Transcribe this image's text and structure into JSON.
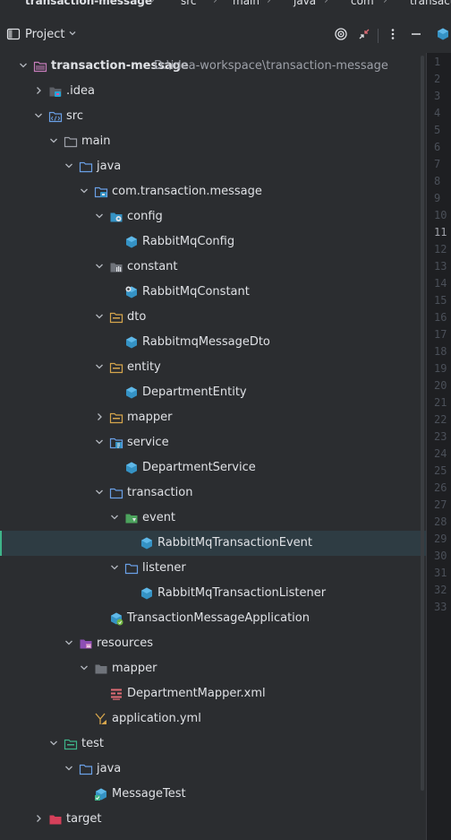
{
  "breadcrumb": [
    "transaction-message",
    "src",
    "main",
    "java",
    "com",
    "transact"
  ],
  "toolwindow": {
    "title": "Project"
  },
  "project_path": "D:\\idea-workspace\\transaction-message",
  "tree": [
    {
      "label": "transaction-message",
      "chevron": "down",
      "icon": "module",
      "bold": true
    },
    {
      "label": ".idea",
      "chevron": "right",
      "icon": "idea-folder"
    },
    {
      "label": "src",
      "chevron": "down",
      "icon": "src-folder"
    },
    {
      "label": "main",
      "chevron": "down",
      "icon": "folder"
    },
    {
      "label": "java",
      "chevron": "down",
      "icon": "source-root"
    },
    {
      "label": "com.transaction.message",
      "chevron": "down",
      "icon": "package-app"
    },
    {
      "label": "config",
      "chevron": "down",
      "icon": "config-folder"
    },
    {
      "label": "RabbitMqConfig",
      "chevron": "none",
      "icon": "class"
    },
    {
      "label": "constant",
      "chevron": "down",
      "icon": "constant-folder"
    },
    {
      "label": "RabbitMqConstant",
      "chevron": "none",
      "icon": "constant-class"
    },
    {
      "label": "dto",
      "chevron": "down",
      "icon": "package"
    },
    {
      "label": "RabbitmqMessageDto",
      "chevron": "none",
      "icon": "class"
    },
    {
      "label": "entity",
      "chevron": "down",
      "icon": "package"
    },
    {
      "label": "DepartmentEntity",
      "chevron": "none",
      "icon": "class"
    },
    {
      "label": "mapper",
      "chevron": "right",
      "icon": "package"
    },
    {
      "label": "service",
      "chevron": "down",
      "icon": "service-folder"
    },
    {
      "label": "DepartmentService",
      "chevron": "none",
      "icon": "class"
    },
    {
      "label": "transaction",
      "chevron": "down",
      "icon": "source-root"
    },
    {
      "label": "event",
      "chevron": "down",
      "icon": "event-folder"
    },
    {
      "label": "RabbitMqTransactionEvent",
      "chevron": "none",
      "icon": "class",
      "selected": true
    },
    {
      "label": "listener",
      "chevron": "down",
      "icon": "source-root"
    },
    {
      "label": "RabbitMqTransactionListener",
      "chevron": "none",
      "icon": "class"
    },
    {
      "label": "TransactionMessageApplication",
      "chevron": "none",
      "icon": "spring-class"
    },
    {
      "label": "resources",
      "chevron": "down",
      "icon": "resources-folder"
    },
    {
      "label": "mapper",
      "chevron": "down",
      "icon": "folder-plain"
    },
    {
      "label": "DepartmentMapper.xml",
      "chevron": "none",
      "icon": "xml-file"
    },
    {
      "label": "application.yml",
      "chevron": "none",
      "icon": "yml-file"
    },
    {
      "label": "test",
      "chevron": "down",
      "icon": "test-folder"
    },
    {
      "label": "java",
      "chevron": "down",
      "icon": "source-root"
    },
    {
      "label": "MessageTest",
      "chevron": "none",
      "icon": "test-class"
    },
    {
      "label": "target",
      "chevron": "right",
      "icon": "target-folder"
    }
  ],
  "line_numbers": [
    "1",
    "2",
    "3",
    "4",
    "5",
    "6",
    "7",
    "8",
    "9",
    "10",
    "11",
    "12",
    "13",
    "14",
    "15",
    "16",
    "17",
    "18",
    "19",
    "20",
    "21",
    "22",
    "23",
    "24",
    "25",
    "26",
    "27",
    "28",
    "29",
    "30",
    "31",
    "32",
    "33"
  ],
  "current_line": "11",
  "colors": {
    "background": "#2b2d30",
    "selection": "#2e3c43",
    "accent": "#3eb489",
    "class_icon": "#3592c4"
  }
}
